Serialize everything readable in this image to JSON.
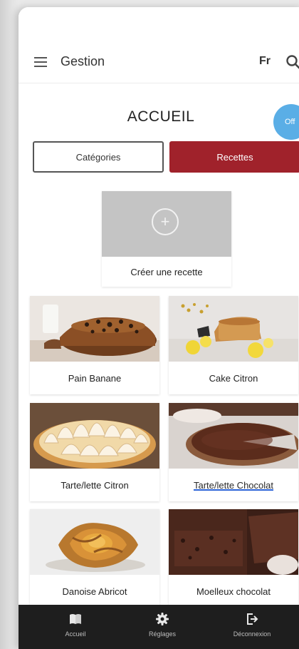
{
  "appbar": {
    "title": "Gestion",
    "lang": "Fr"
  },
  "page": {
    "title": "ACCUEIL",
    "fab_label": "Off"
  },
  "tabs": [
    {
      "label": "Catégories"
    },
    {
      "label": "Recettes"
    }
  ],
  "create": {
    "label": "Créer une recette",
    "icon": "plus-icon"
  },
  "recipes": [
    {
      "label": "Pain Banane"
    },
    {
      "label": "Cake Citron"
    },
    {
      "label": "Tarte/lette Citron"
    },
    {
      "label": "Tarte/lette Chocolat"
    },
    {
      "label": "Danoise Abricot"
    },
    {
      "label": "Moelleux chocolat"
    }
  ],
  "bottom_nav": [
    {
      "label": "Accueil",
      "icon": "book-icon"
    },
    {
      "label": "Réglages",
      "icon": "gear-icon"
    },
    {
      "label": "Déconnexion",
      "icon": "logout-icon"
    }
  ],
  "colors": {
    "accent": "#a0222b",
    "fab": "#5aaee6",
    "nav_bg": "#1e1e1e"
  }
}
